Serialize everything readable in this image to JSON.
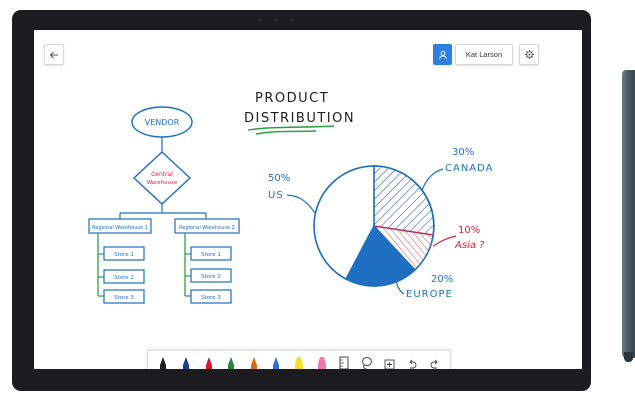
{
  "header": {
    "user_name": "Kat Larson",
    "icons": [
      "back-arrow-icon",
      "user-icon",
      "gear-icon"
    ]
  },
  "whiteboard": {
    "title_line1": "PRODUCT",
    "title_line2": "DISTRIBUTION",
    "flowchart": {
      "vendor": "VENDOR",
      "central_line1": "Central",
      "central_line2": "Warehouse",
      "regional_left": "Regional Warehouse 1",
      "regional_right": "Regional Warehouse 2",
      "stores_left": [
        "Store 1",
        "Store 2",
        "Store 3"
      ],
      "stores_right": [
        "Store 1",
        "Store 2",
        "Store 3"
      ]
    },
    "pie_labels": {
      "us_pct": "50%",
      "us_name": "US",
      "canada_pct": "30%",
      "canada_name": "CANADA",
      "asia_pct": "10%",
      "asia_name": "Asia ?",
      "europe_pct": "20%",
      "europe_name": "EUROPE"
    },
    "pie_values": {
      "US": 50,
      "CANADA": 30,
      "Asia": 10,
      "EUROPE": 20
    }
  },
  "toolbar": {
    "pens": [
      {
        "name": "black",
        "color": "#1e1e1e"
      },
      {
        "name": "dark-blue",
        "color": "#1f3a8f"
      },
      {
        "name": "red",
        "color": "#d0182f"
      },
      {
        "name": "green",
        "color": "#1e8a3a"
      },
      {
        "name": "orange",
        "color": "#e06a14"
      },
      {
        "name": "blue",
        "color": "#2e6fd8"
      },
      {
        "name": "highlighter-yellow",
        "color": "#f4e22b"
      },
      {
        "name": "highlighter-pink",
        "color": "#f07aa8"
      }
    ],
    "tools": [
      "ruler-icon",
      "lasso-icon",
      "add-icon",
      "undo-icon",
      "redo-icon"
    ]
  },
  "colors": {
    "ink_blue": "#1f6fc2",
    "ink_red": "#d61f3c",
    "ink_green": "#2ea043",
    "accent": "#2f7fe0"
  }
}
